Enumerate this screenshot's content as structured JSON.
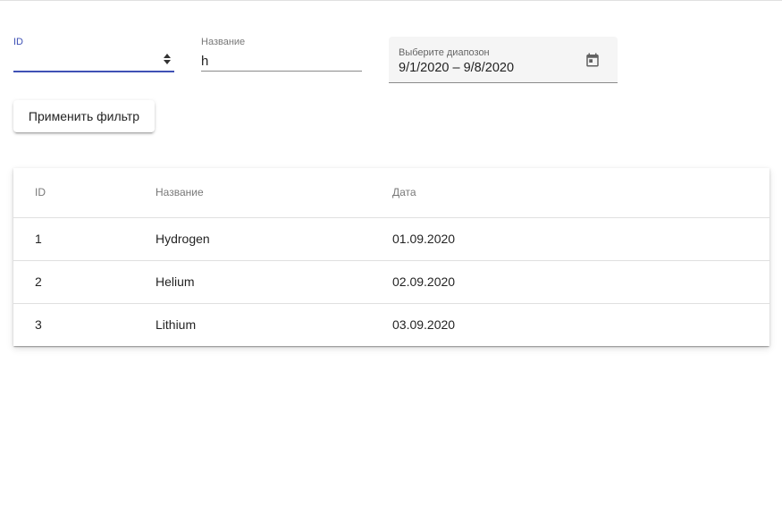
{
  "filters": {
    "id": {
      "label": "ID",
      "value": ""
    },
    "name": {
      "label": "Название",
      "value": "h"
    },
    "date_range": {
      "label": "Выберите диапозон",
      "value": "9/1/2020 – 9/8/2020",
      "icon": "calendar-icon"
    }
  },
  "apply_button": {
    "label": "Применить фильтр"
  },
  "table": {
    "columns": [
      "ID",
      "Название",
      "Дата"
    ],
    "rows": [
      {
        "id": "1",
        "name": "Hydrogen",
        "date": "01.09.2020"
      },
      {
        "id": "2",
        "name": "Helium",
        "date": "02.09.2020"
      },
      {
        "id": "3",
        "name": "Lithium",
        "date": "03.09.2020"
      }
    ]
  },
  "colors": {
    "accent": "#3f51b5",
    "divider": "#e0e0e0",
    "field_fill": "#f5f5f5"
  }
}
